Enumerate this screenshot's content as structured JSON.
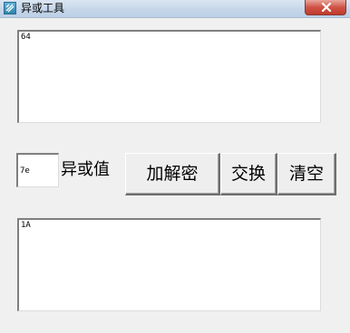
{
  "window": {
    "title": "异或工具"
  },
  "input_text": "64",
  "xor": {
    "value": "7e",
    "label": "异或值"
  },
  "buttons": {
    "encrypt": "加解密",
    "swap": "交换",
    "clear": "清空"
  },
  "output_text": "1A"
}
